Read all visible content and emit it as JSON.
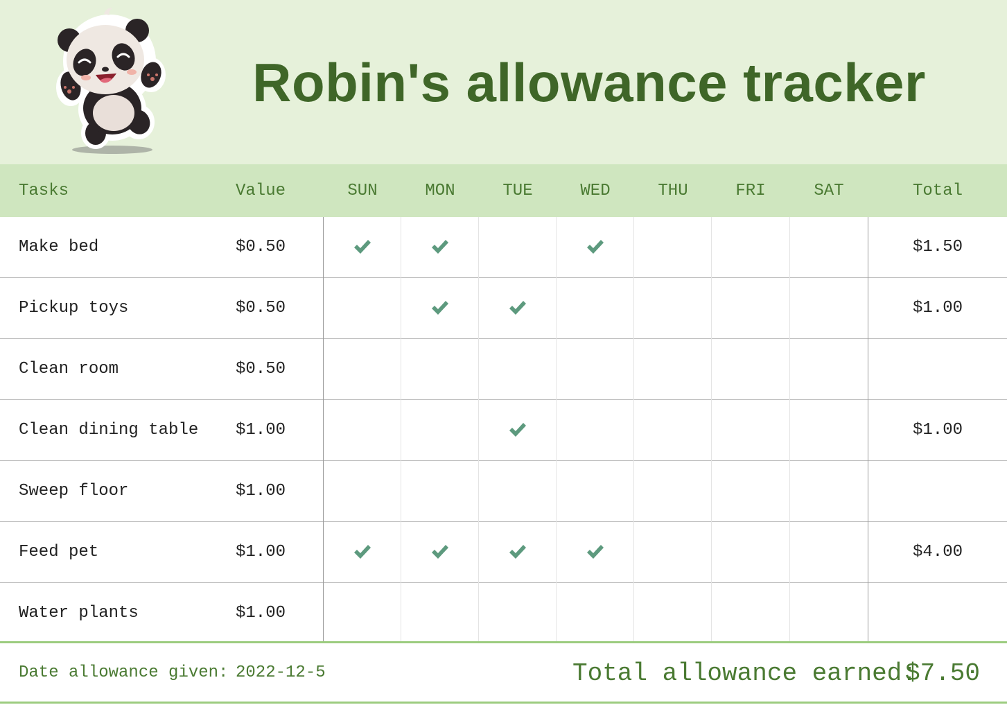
{
  "title": "Robin's allowance tracker",
  "colors": {
    "banner_bg": "#e6f1da",
    "header_bg": "#cfe6bf",
    "title_color": "#3f6628",
    "accent_green": "#4a7a32",
    "check_color": "#5d9a7e",
    "footer_rule": "#9ccc7f"
  },
  "mascot_icon": "panda-icon",
  "check_icon": "checkmark-icon",
  "header": {
    "tasks": "Tasks",
    "value": "Value",
    "days": [
      "SUN",
      "MON",
      "TUE",
      "WED",
      "THU",
      "FRI",
      "SAT"
    ],
    "total": "Total"
  },
  "rows": [
    {
      "task": "Make bed",
      "value": "$0.50",
      "checks": [
        true,
        true,
        false,
        true,
        false,
        false,
        false
      ],
      "total": "$1.50"
    },
    {
      "task": "Pickup toys",
      "value": "$0.50",
      "checks": [
        false,
        true,
        true,
        false,
        false,
        false,
        false
      ],
      "total": "$1.00"
    },
    {
      "task": "Clean room",
      "value": "$0.50",
      "checks": [
        false,
        false,
        false,
        false,
        false,
        false,
        false
      ],
      "total": ""
    },
    {
      "task": "Clean dining table",
      "value": "$1.00",
      "checks": [
        false,
        false,
        true,
        false,
        false,
        false,
        false
      ],
      "total": "$1.00"
    },
    {
      "task": "Sweep floor",
      "value": "$1.00",
      "checks": [
        false,
        false,
        false,
        false,
        false,
        false,
        false
      ],
      "total": ""
    },
    {
      "task": "Feed pet",
      "value": "$1.00",
      "checks": [
        true,
        true,
        true,
        true,
        false,
        false,
        false
      ],
      "total": "$4.00"
    },
    {
      "task": "Water plants",
      "value": "$1.00",
      "checks": [
        false,
        false,
        false,
        false,
        false,
        false,
        false
      ],
      "total": ""
    }
  ],
  "footer": {
    "date_label": "Date allowance given:",
    "date_value": "2022-12-5",
    "total_label": "Total allowance earned:",
    "total_value": "$7.50"
  }
}
